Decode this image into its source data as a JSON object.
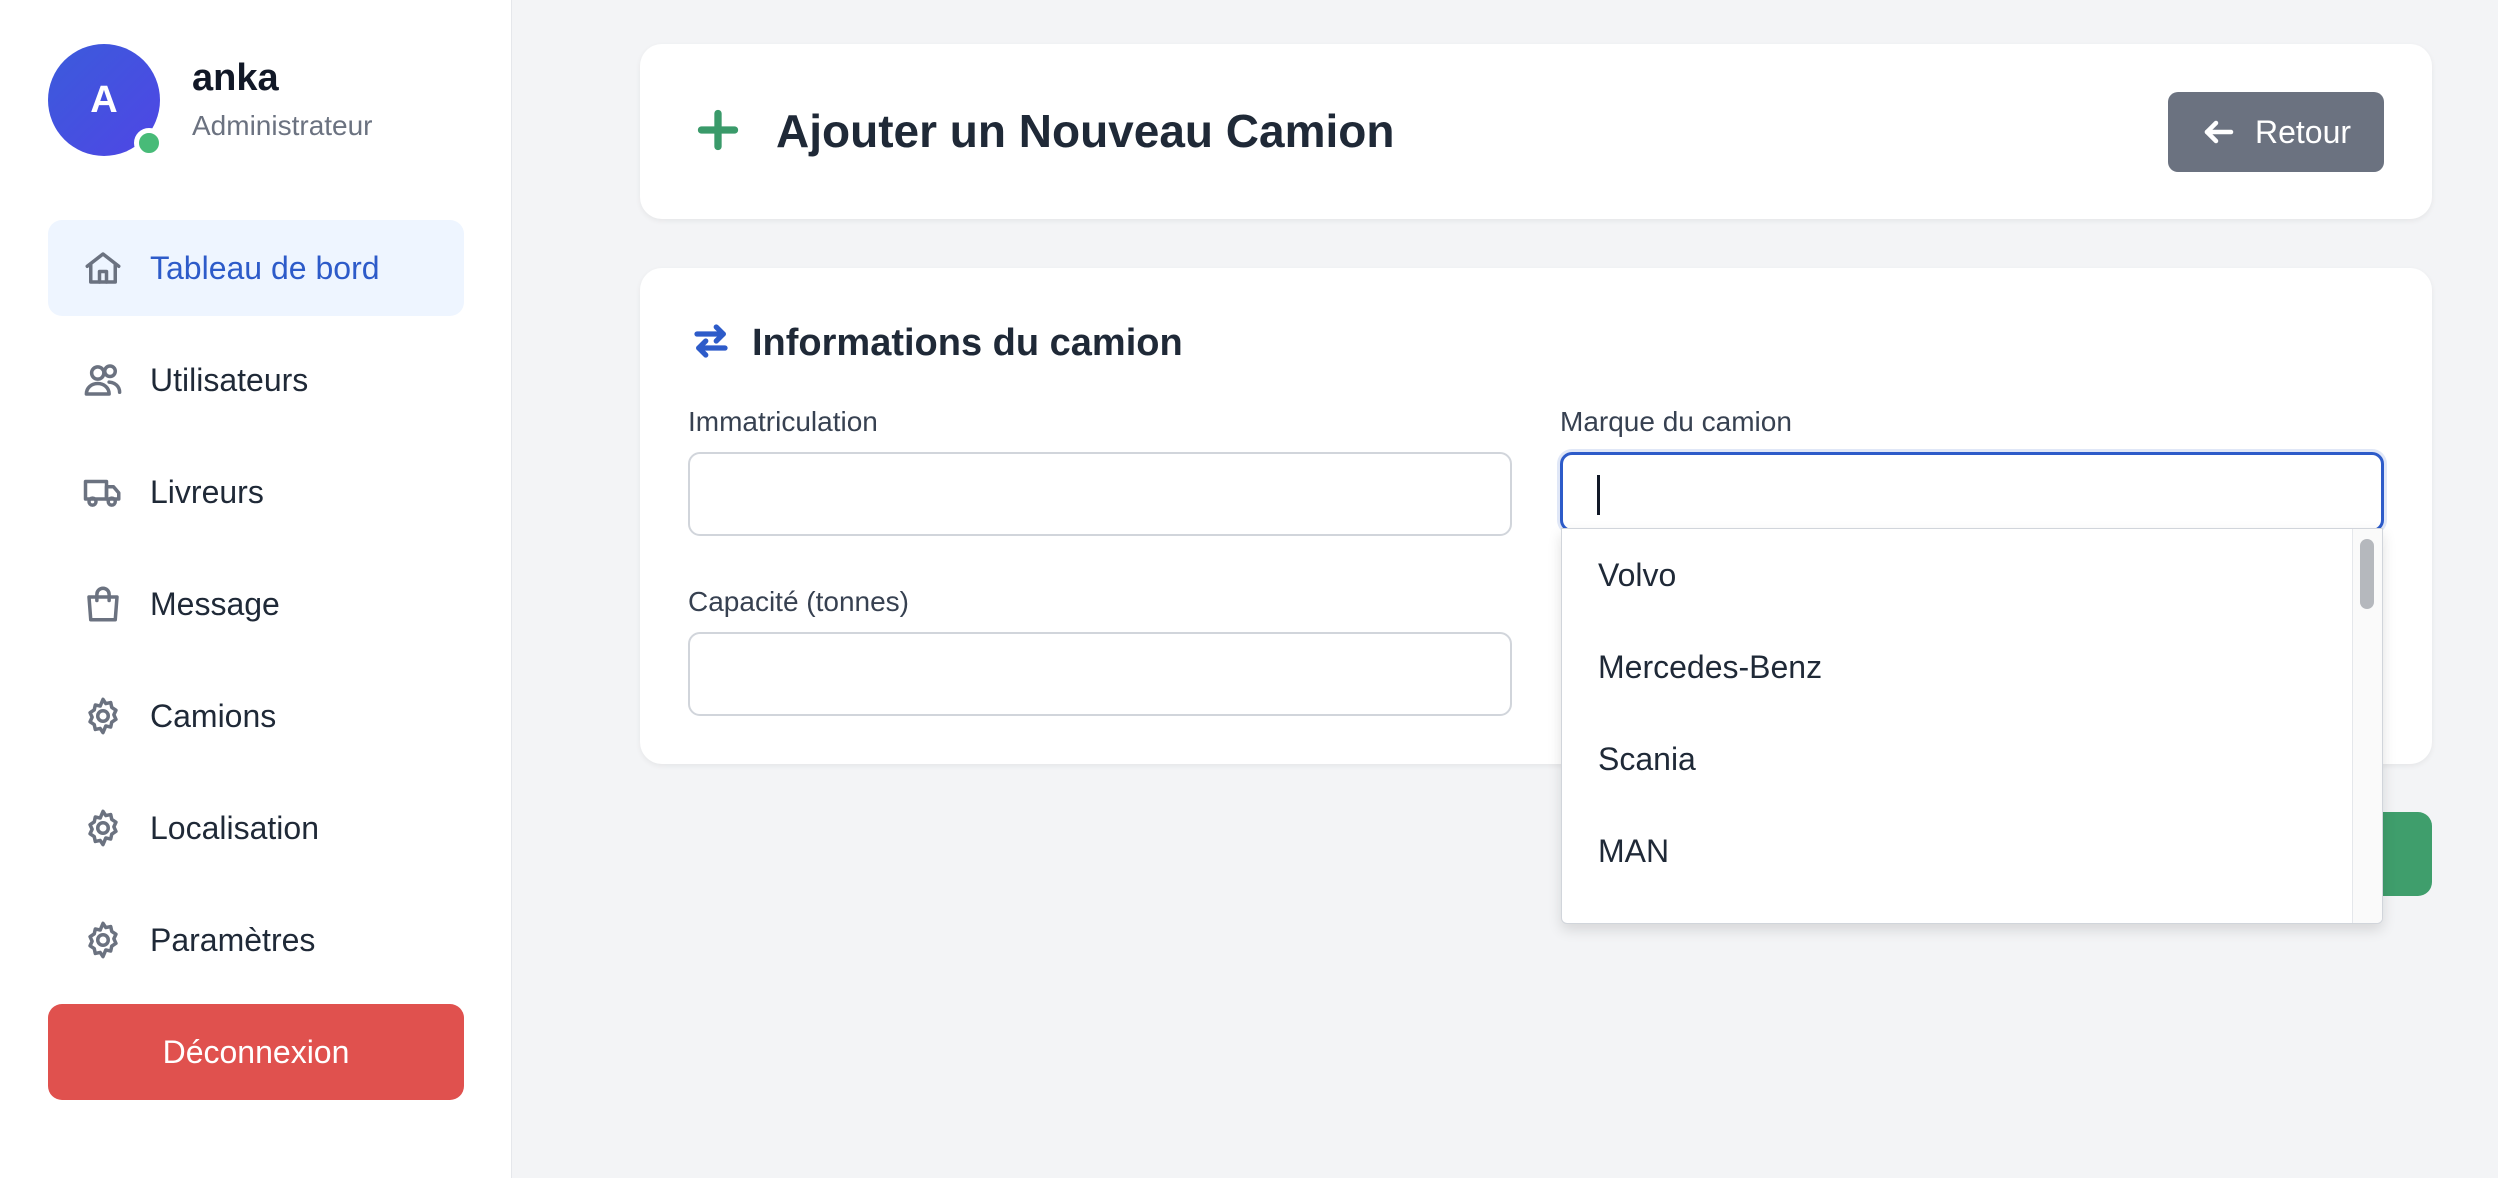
{
  "profile": {
    "initial": "A",
    "name": "anka",
    "role": "Administrateur"
  },
  "nav": {
    "items": [
      {
        "label": "Tableau de bord",
        "icon": "home-icon"
      },
      {
        "label": "Utilisateurs",
        "icon": "users-icon"
      },
      {
        "label": "Livreurs",
        "icon": "truck-icon"
      },
      {
        "label": "Message",
        "icon": "bag-icon"
      },
      {
        "label": "Camions",
        "icon": "gear-icon"
      },
      {
        "label": "Localisation",
        "icon": "gear-icon"
      },
      {
        "label": "Paramètres",
        "icon": "gear-icon"
      }
    ],
    "active": "Tableau de bord",
    "logout_label": "Déconnexion"
  },
  "header": {
    "title": "Ajouter un Nouveau Camion",
    "back_label": "Retour"
  },
  "form": {
    "section_title": "Informations du camion",
    "immatriculation_label": "Immatriculation",
    "immatriculation_value": "",
    "marque_label": "Marque du camion",
    "marque_value": "",
    "capacite_label": "Capacité (tonnes)",
    "capacite_value": ""
  },
  "dropdown": {
    "options": [
      "Volvo",
      "Mercedes-Benz",
      "Scania",
      "MAN"
    ]
  },
  "colors": {
    "accent": "#2d5bc9",
    "active_bg": "#eef5ff",
    "danger": "#e0514e",
    "success": "#3f9e6c",
    "secondary_button": "#6b7280"
  }
}
